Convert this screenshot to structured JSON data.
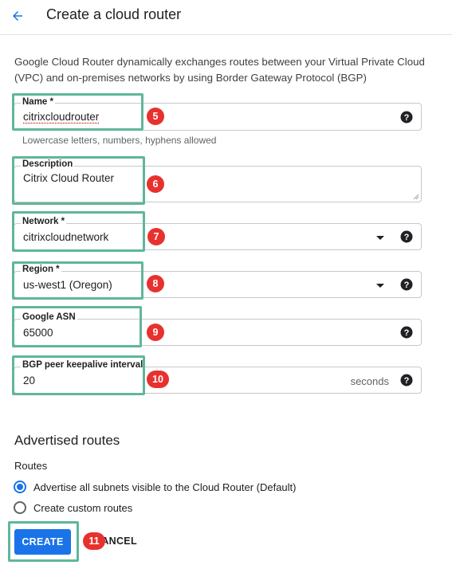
{
  "header": {
    "title": "Create a cloud router",
    "back_icon": "arrow-back-icon",
    "accent_color": "#1a73e8"
  },
  "intro": "Google Cloud Router dynamically exchanges routes between your Virtual Private Cloud (VPC) and on-premises networks by using Border Gateway Protocol (BGP)",
  "fields": {
    "name": {
      "label": "Name *",
      "value": "citrixcloudrouter",
      "hint": "Lowercase letters, numbers, hyphens allowed"
    },
    "description": {
      "label": "Description",
      "value": "Citrix Cloud Router"
    },
    "network": {
      "label": "Network *",
      "value": "citrixcloudnetwork"
    },
    "region": {
      "label": "Region *",
      "value": "us-west1 (Oregon)"
    },
    "asn": {
      "label": "Google ASN",
      "value": "65000"
    },
    "keepalive": {
      "label": "BGP peer keepalive interval",
      "value": "20",
      "suffix": "seconds"
    }
  },
  "advertised": {
    "title": "Advertised routes",
    "routes_label": "Routes",
    "options": [
      {
        "label": "Advertise all subnets visible to the Cloud Router (Default)",
        "selected": true
      },
      {
        "label": "Create custom routes",
        "selected": false
      }
    ]
  },
  "actions": {
    "create_label": "CREATE",
    "cancel_label": "CANCEL"
  },
  "steps": [
    "5",
    "6",
    "7",
    "8",
    "9",
    "10",
    "11"
  ],
  "colors": {
    "highlight": "#5fb79a",
    "step_badge": "#e8312f",
    "primary_button": "#1a73e8"
  }
}
